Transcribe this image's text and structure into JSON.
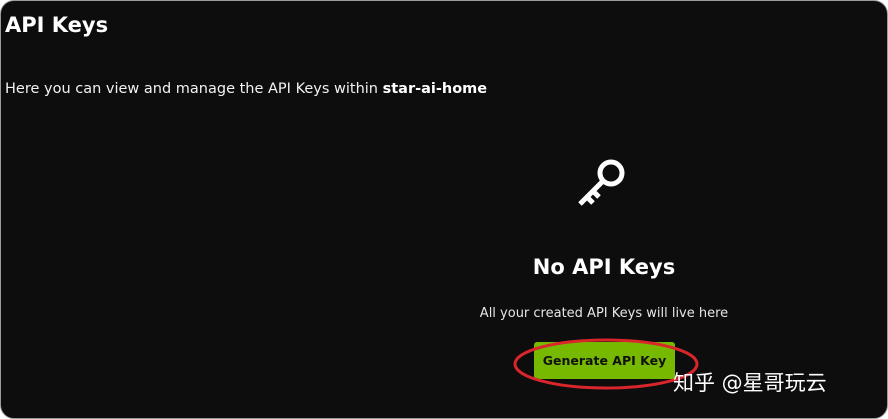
{
  "header": {
    "title": "API Keys"
  },
  "description": {
    "prefix": "Here you can view and manage the API Keys within ",
    "project_name": "star-ai-home"
  },
  "empty_state": {
    "icon": "key-icon",
    "title": "No API Keys",
    "subtitle": "All your created API Keys will live here",
    "button_label": "Generate API Key"
  },
  "colors": {
    "background": "#0d0d0d",
    "button": "#76b900",
    "annotation": "#d9262b"
  },
  "watermark": {
    "text": "知乎 @星哥玩云"
  }
}
